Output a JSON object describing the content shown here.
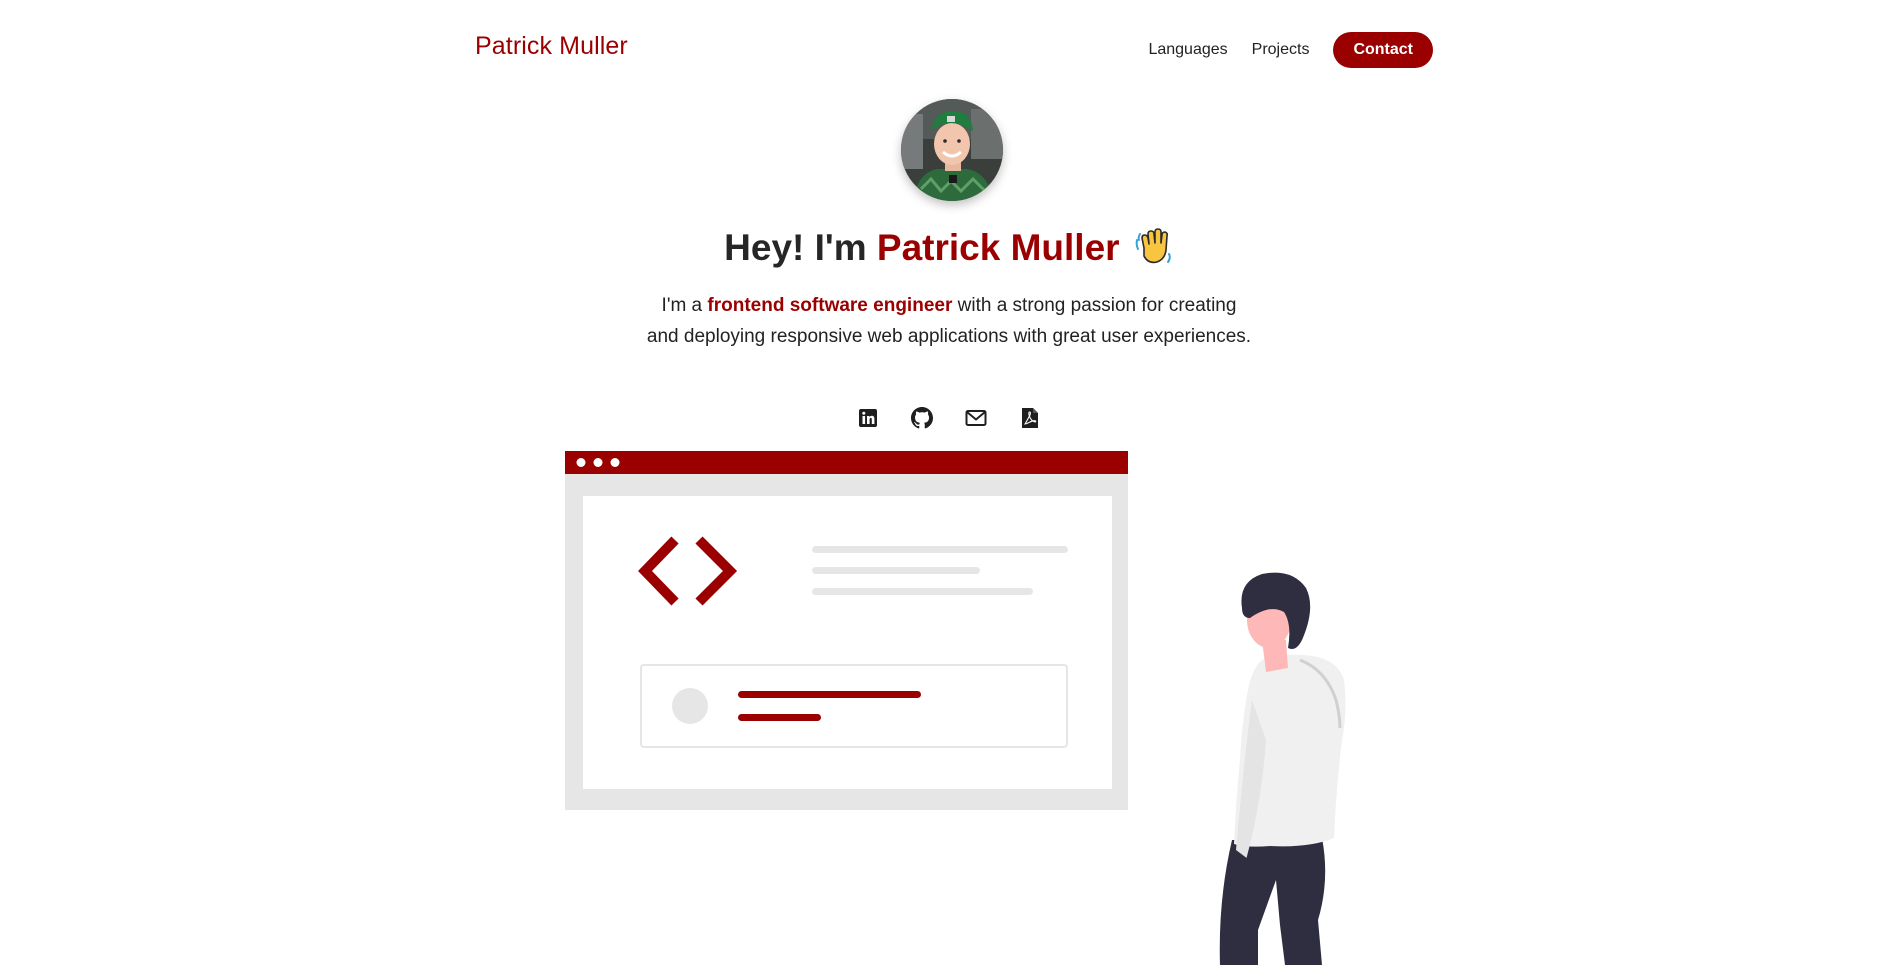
{
  "header": {
    "brand": "Patrick Muller",
    "nav": {
      "languages": "Languages",
      "projects": "Projects",
      "contact": "Contact"
    }
  },
  "hero": {
    "greeting": "Hey! I'm",
    "name": "Patrick Muller",
    "wave_icon": "waving-hand-emoji",
    "intro_prefix": "I'm a",
    "intro_highlight": "frontend software engineer",
    "intro_rest": "with a strong passion for creating and deploying responsive web applications with great user experiences."
  },
  "socials": [
    {
      "icon": "linkedin-icon"
    },
    {
      "icon": "github-icon"
    },
    {
      "icon": "mail-icon"
    },
    {
      "icon": "pdf-resume-icon"
    }
  ],
  "colors": {
    "accent": "#9b0000",
    "text": "#222222",
    "light_gray": "#e6e6e6",
    "figure_dark": "#2f2e41",
    "skin": "#ffb8b8"
  }
}
